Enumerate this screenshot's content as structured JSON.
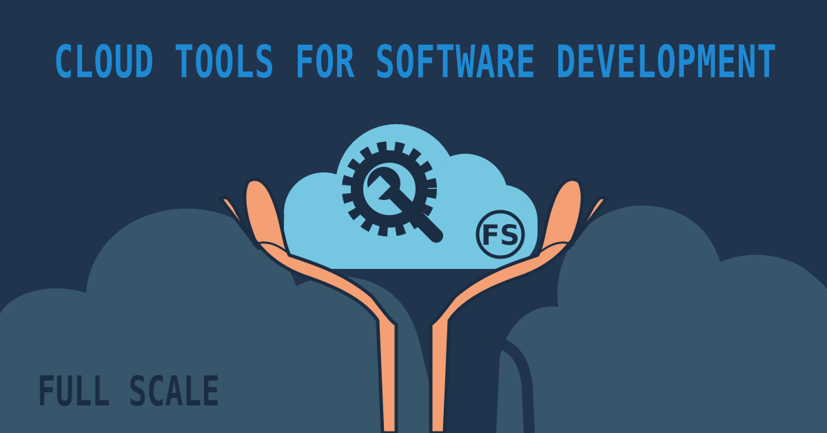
{
  "headline": "CLOUD TOOLS FOR SOFTWARE DEVELOPMENT",
  "brand": {
    "wordmark": "FULL SCALE",
    "badge_text": "FS"
  },
  "icons": [
    "gear-wrench-icon",
    "cloud-icon",
    "open-hands-icon"
  ],
  "colors": {
    "background": "#20344d",
    "background_clouds": "#37566b",
    "accent": "#1f8ad4",
    "cloud": "#75c6e1",
    "icon_dark": "#1b2d43",
    "skin": "#f49f74"
  }
}
